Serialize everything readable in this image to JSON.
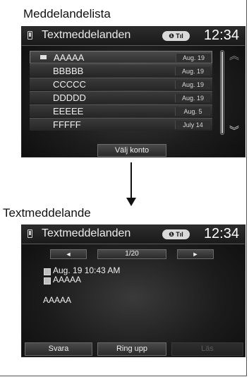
{
  "sections": {
    "list_label": "Meddelandelista",
    "detail_label": "Textmeddelande"
  },
  "header": {
    "title": "Textmeddelanden",
    "status": "❶ Tıl",
    "clock": "12:34",
    "phone_icon": "phone-icon"
  },
  "list": {
    "messages": [
      {
        "sender": "AAAAA",
        "date": "Aug. 19",
        "unread_icon": "envelope-icon"
      },
      {
        "sender": "BBBBB",
        "date": "Aug. 19"
      },
      {
        "sender": "CCCCC",
        "date": "Aug. 19"
      },
      {
        "sender": "DDDDD",
        "date": "Aug. 19"
      },
      {
        "sender": "EEEEE",
        "date": "Aug. 5"
      },
      {
        "sender": "FFFFF",
        "date": "July 14"
      }
    ],
    "select_account": "Välj konto",
    "scroll_up_icon": "chevron-up-icon",
    "scroll_down_icon": "chevron-down-icon",
    "scroll_position_fraction": 0.0
  },
  "detail": {
    "prev": "◄",
    "page": "1/20",
    "next": "►",
    "datetime": "Aug. 19 10:43 AM",
    "sender": "AAAAA",
    "body": "AAAAA",
    "actions": {
      "reply": "Svara",
      "call": "Ring upp",
      "read": "Läs"
    }
  }
}
